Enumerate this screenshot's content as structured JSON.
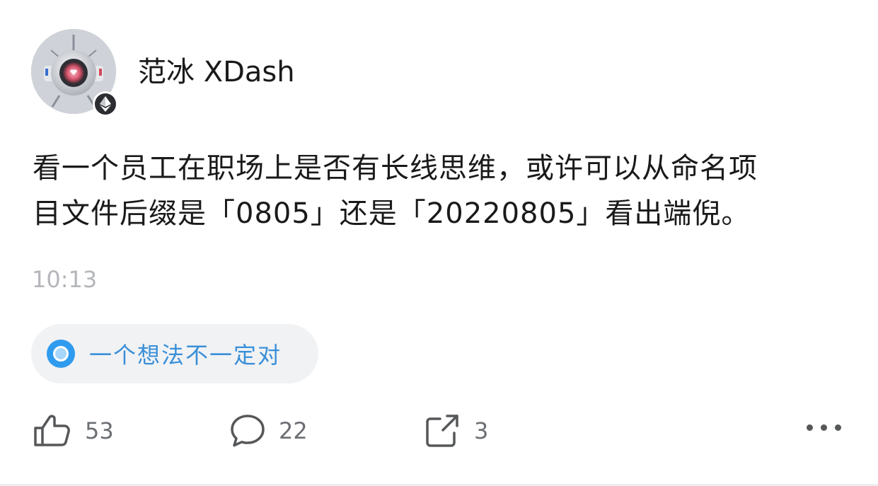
{
  "author": {
    "name": "范冰 XDash",
    "avatar_icon": "robot-avatar",
    "badge_icon": "ethereum-icon"
  },
  "post": {
    "text_line1": "看一个员工在职场上是否有长线思维，或许可以从命名项",
    "text_line2": "目文件后缀是「0805」还是「20220805」看出端倪。",
    "time": "10:13"
  },
  "topic": {
    "label": "一个想法不一定对",
    "icon": "topic-circle-icon",
    "color": "#2f9bef"
  },
  "actions": {
    "like_count": "53",
    "comment_count": "22",
    "share_count": "3"
  },
  "colors": {
    "text": "#1a1a1a",
    "muted": "#b4b6ba",
    "accent": "#3a8fd8"
  }
}
